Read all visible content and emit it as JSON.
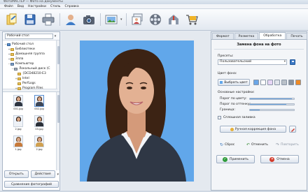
{
  "window": {
    "title": "ФотоМАСТЕР — Фото на документы"
  },
  "menu": [
    "Файл",
    "Вид",
    "Настройки",
    "Стиль",
    "Справка"
  ],
  "toolbar": {
    "buttons": [
      "open-file-icon",
      "save-icon",
      "print-icon",
      "user-icon",
      "camera-icon",
      "photo-frame-icon",
      "gallery-icon",
      "film-icon",
      "upload-icon",
      "cart-icon"
    ]
  },
  "left_panel": {
    "location": "Рабочий стол",
    "tree": [
      {
        "label": "Рабочий стол",
        "icon": "desk",
        "depth": 0,
        "toggle": "−"
      },
      {
        "label": "Библиотеки",
        "icon": "folder",
        "depth": 1,
        "toggle": "+"
      },
      {
        "label": "Домашняя группа",
        "icon": "folder",
        "depth": 1,
        "toggle": "+"
      },
      {
        "label": "Элла",
        "icon": "folder",
        "depth": 1,
        "toggle": "+"
      },
      {
        "label": "Компьютер",
        "icon": "computer",
        "depth": 1,
        "toggle": "−"
      },
      {
        "label": "Локальный диск (C",
        "icon": "disk",
        "depth": 2,
        "toggle": "−"
      },
      {
        "label": "{DCD48210-E3",
        "icon": "folder",
        "depth": 3,
        "toggle": ""
      },
      {
        "label": "Intel",
        "icon": "folder",
        "depth": 3,
        "toggle": "+"
      },
      {
        "label": "PerfLogs",
        "icon": "folder",
        "depth": 3,
        "toggle": ""
      },
      {
        "label": "Program Files",
        "icon": "folder",
        "depth": 3,
        "toggle": "+"
      }
    ],
    "thumbnails": [
      {
        "caption": "001.jpg",
        "hair": "#2b1a10",
        "body": "#2d3440"
      },
      {
        "caption": "002.jpg",
        "hair": "#3b2618",
        "body": "#3d4656"
      },
      {
        "caption": "2.jpg",
        "hair": "#1e1410",
        "body": "#eef1f5"
      },
      {
        "caption": "03.jpg",
        "hair": "#3a2a1c",
        "body": "#2a2f38"
      },
      {
        "caption": "1.jpg",
        "hair": "#6b4a2a",
        "body": "#c77a3a"
      },
      {
        "caption": "2.jpg",
        "hair": "#5a3b22",
        "body": "#d0a050"
      }
    ],
    "open_label": "Открыть",
    "actions_label": "Действия",
    "compare_label": "Сравнение фотографий"
  },
  "panel": {
    "tabs": [
      "Формат",
      "Разметка",
      "Обработка",
      "Печать"
    ],
    "active_tab": "Обработка",
    "title": "Замена фона на фото",
    "presets_label": "Пресеты:",
    "preset_value": "Пользовательский",
    "bg_color_label": "Цвет фона:",
    "choose_color_label": "Выбрать цвет",
    "swatches": [
      "#6aa6e8",
      "#ffffff",
      "#e7d6f5",
      "#e0e4ea",
      "#b9c0c8",
      "#8a929c",
      "#f08a24"
    ],
    "basic_settings_label": "Основные настройки:",
    "sliders": [
      {
        "label": "Порог по цвету:",
        "value": 0.95
      },
      {
        "label": "Порог по оттенку:",
        "value": 0.82
      },
      {
        "label": "Граница:",
        "value": 0.22
      }
    ],
    "solid_fill_label": "Сплошная заливка",
    "manual_label": "Ручная коррекция фона",
    "reset_label": "Сброс",
    "undo_label": "Отменить",
    "redo_label": "Повторить",
    "apply_label": "Применить",
    "cancel_label": "Отмена"
  },
  "colors": {
    "photo_bg": "#61a7ea",
    "apply_icon": "#2e9b3a",
    "cancel_icon": "#d23a2a"
  }
}
